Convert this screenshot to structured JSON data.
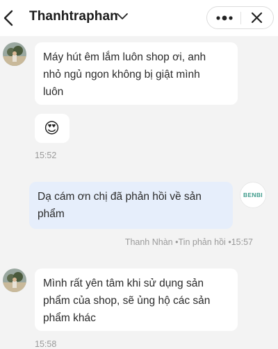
{
  "header": {
    "title": "Thanhtraphan"
  },
  "messages": [
    {
      "lines": [
        "Máy hút êm lắm luôn shop ơi, anh",
        "nhỏ ngủ ngon không bị giật mình",
        "luôn"
      ],
      "emoji": "😍",
      "time": "15:52"
    },
    {
      "lines": [
        "Dạ cám ơn chị đã phản hồi về sản",
        "phẩm"
      ],
      "sender": "Thanh Nhàn",
      "status": "Tin phản hồi",
      "time": "15:57",
      "brand_logo_text": "BENBI"
    },
    {
      "lines": [
        "Mình rất yên tâm khi sử dụng sản",
        "phẩm của shop, sẽ ủng hộ các sản",
        "phẩm khác"
      ],
      "time": "15:58"
    }
  ],
  "colors": {
    "background": "#f3f3f3",
    "incoming_bubble": "#ffffff",
    "outgoing_bubble": "#e6eefb",
    "timestamp": "#9a9a9a"
  },
  "icons": [
    "back-arrow-icon",
    "chevron-down-icon",
    "more-icon",
    "close-icon",
    "avatar",
    "brand-logo"
  ]
}
